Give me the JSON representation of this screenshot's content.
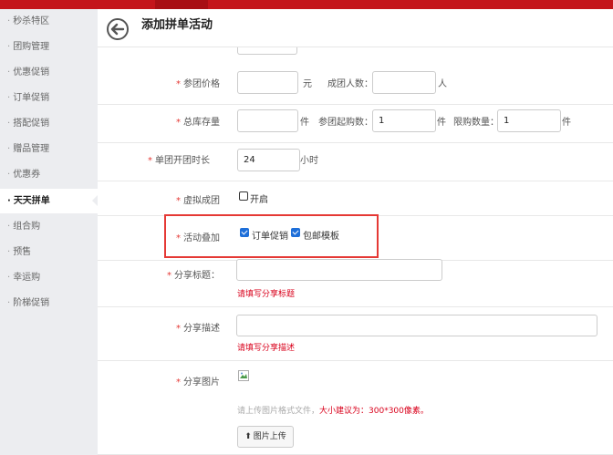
{
  "sidebar": {
    "items": [
      {
        "label": "秒杀特区",
        "active": false
      },
      {
        "label": "团购管理",
        "active": false
      },
      {
        "label": "优惠促销",
        "active": false
      },
      {
        "label": "订单促销",
        "active": false
      },
      {
        "label": "搭配促销",
        "active": false
      },
      {
        "label": "赠品管理",
        "active": false
      },
      {
        "label": "优惠券",
        "active": false
      },
      {
        "label": "天天拼单",
        "active": true
      },
      {
        "label": "组合购",
        "active": false
      },
      {
        "label": "预售",
        "active": false
      },
      {
        "label": "幸运购",
        "active": false
      },
      {
        "label": "阶梯促销",
        "active": false
      }
    ]
  },
  "header": {
    "title": "添加拼单活动"
  },
  "form": {
    "price": {
      "label": "参团价格",
      "value": "",
      "unit": "元"
    },
    "group_size": {
      "label": "成团人数：",
      "value": "",
      "unit": "人"
    },
    "stock": {
      "label": "总库存量",
      "value": "",
      "unit": "件"
    },
    "min_buy": {
      "label": "参团起购数：",
      "value": "1",
      "unit": "件"
    },
    "limit": {
      "label": "限购数量：",
      "value": "1",
      "unit": "件"
    },
    "duration": {
      "label": "单团开团时长",
      "value": "24",
      "unit": "小时"
    },
    "virtual": {
      "label": "虚拟成团",
      "option": "开启",
      "checked": false
    },
    "stack": {
      "label": "活动叠加",
      "options": [
        {
          "label": "订单促销",
          "checked": true
        },
        {
          "label": "包邮模板",
          "checked": true
        }
      ]
    },
    "share_title": {
      "label": "分享标题：",
      "value": "",
      "error": "请填写分享标题"
    },
    "share_desc": {
      "label": "分享描述",
      "value": "",
      "error": "请填写分享描述"
    },
    "share_image": {
      "label": "分享图片",
      "hint": "请上传图片格式文件，",
      "hint_strong": "大小建议为：300*300像素。",
      "upload_label": "图片上传"
    }
  },
  "colors": {
    "accent": "#c4151b",
    "required": "#e53935",
    "error": "#d9001b",
    "checkbox": "#1e6fd9"
  }
}
